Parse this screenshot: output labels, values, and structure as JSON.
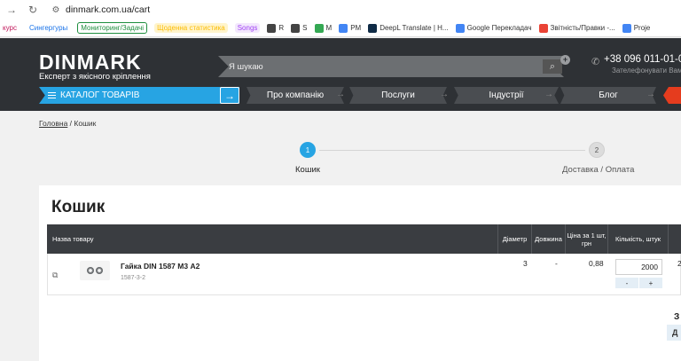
{
  "browser": {
    "url": "dinmark.com.ua/cart",
    "bookmarks": [
      {
        "label": "курс",
        "color": "#c2185b"
      },
      {
        "label": "Сингергуры",
        "color": "#1a73e8"
      },
      {
        "label": "Мониторинг/Задачі",
        "color": "#1e8e3e"
      },
      {
        "label": "Щоденна статистика",
        "color": "#fbbc04"
      },
      {
        "label": "Songs",
        "color": "#a142f4"
      },
      {
        "label": "R",
        "color": "#444444"
      },
      {
        "label": "S",
        "color": "#444444"
      },
      {
        "label": "M",
        "color": "#34a853"
      },
      {
        "label": "PM",
        "color": "#4285f4"
      },
      {
        "label": "DeepL Translate | H...",
        "color": "#0f2b46"
      },
      {
        "label": "Google Перекладач",
        "color": "#4285f4"
      },
      {
        "label": "Звітність/Правки -...",
        "color": "#ea4335"
      },
      {
        "label": "Proje",
        "color": "#4285f4"
      }
    ]
  },
  "header": {
    "logo": "DINMARK",
    "tagline": "Експерт з якісного кріплення",
    "search_placeholder": "Я шукаю",
    "phone": "+38 096 011-01-0",
    "callback": "Зателефонувати Вам?",
    "catalog_label": "КАТАЛОГ ТОВАРІВ",
    "menu": [
      {
        "label": "Про компанію"
      },
      {
        "label": "Послуги"
      },
      {
        "label": "Індустрії"
      },
      {
        "label": "Блог"
      }
    ]
  },
  "breadcrumb": {
    "home": "Головна",
    "separator": "/",
    "current": "Кошик"
  },
  "steps": [
    {
      "num": "1",
      "label": "Кошик",
      "active": true
    },
    {
      "num": "2",
      "label": "Доставка / Оплата",
      "active": false
    }
  ],
  "cart": {
    "title": "Кошик",
    "columns": {
      "name": "Назва товару",
      "diameter": "Діаметр",
      "length": "Довжина",
      "price_line1": "Ціна за 1 шт,",
      "price_line2": "грн",
      "qty": "Кількість, штук"
    },
    "items": [
      {
        "name": "Гайка DIN 1587 М3 А2",
        "sku": "1587-3-2",
        "diameter": "3",
        "length": "-",
        "price": "0,88",
        "qty": "2000",
        "sum_partial": "2"
      }
    ],
    "qty_minus": "-",
    "qty_plus": "+",
    "side_text_partial": "З",
    "side_button_partial": "Д"
  }
}
